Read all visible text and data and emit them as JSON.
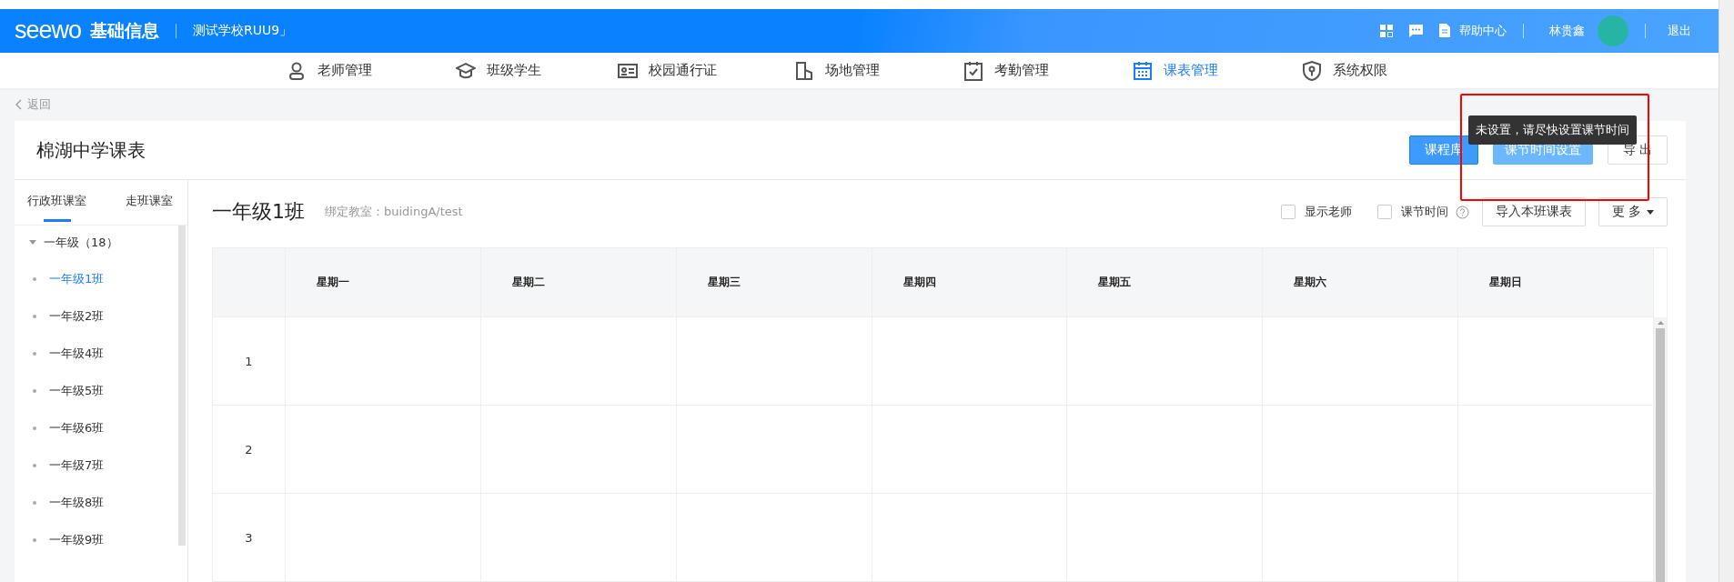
{
  "header": {
    "logo": "seewo",
    "app_name": "基础信息",
    "school": "测试学校RUU9」",
    "help": "帮助中心",
    "user": "林贵鑫",
    "logout": "退出"
  },
  "nav": [
    {
      "label": "老师管理",
      "selected": false
    },
    {
      "label": "班级学生",
      "selected": false
    },
    {
      "label": "校园通行证",
      "selected": false
    },
    {
      "label": "场地管理",
      "selected": false
    },
    {
      "label": "考勤管理",
      "selected": false
    },
    {
      "label": "课表管理",
      "selected": true
    },
    {
      "label": "系统权限",
      "selected": false
    }
  ],
  "back": "返回",
  "page_title": "棉湖中学课表",
  "buttons": [
    {
      "label": "课程库",
      "kind": "primary"
    },
    {
      "label": "课节时间设置",
      "kind": "light"
    },
    {
      "label": "导 出",
      "kind": "default"
    }
  ],
  "tooltip": "未设置，请尽快设置课节时间",
  "sidebar": {
    "tabs": [
      {
        "label": "行政班课室",
        "selected": true
      },
      {
        "label": "走班课室",
        "selected": false
      }
    ],
    "tree": [
      {
        "label": "一年级（18）",
        "expanded": true,
        "children": [
          {
            "label": "一年级1班",
            "selected": true
          },
          {
            "label": "一年级2班",
            "selected": false
          },
          {
            "label": "一年级4班",
            "selected": false
          },
          {
            "label": "一年级5班",
            "selected": false
          },
          {
            "label": "一年级6班",
            "selected": false
          },
          {
            "label": "一年级7班",
            "selected": false
          },
          {
            "label": "一年级8班",
            "selected": false
          },
          {
            "label": "一年级9班",
            "selected": false
          }
        ]
      }
    ]
  },
  "class_title": "一年级1班",
  "classroom": "绑定教室：buidingA/test",
  "options": [
    {
      "label": "显示老师",
      "checked": false,
      "help": false
    },
    {
      "label": "课节时间",
      "checked": false,
      "help": true
    }
  ],
  "actions": [
    {
      "label": "导入本班课表",
      "caret": false
    },
    {
      "label": "更 多",
      "caret": true
    }
  ],
  "table": {
    "columns": [
      "星期一",
      "星期二",
      "星期三",
      "星期四",
      "星期五",
      "星期六",
      "星期日"
    ],
    "rows": [
      "1",
      "2",
      "3"
    ]
  }
}
